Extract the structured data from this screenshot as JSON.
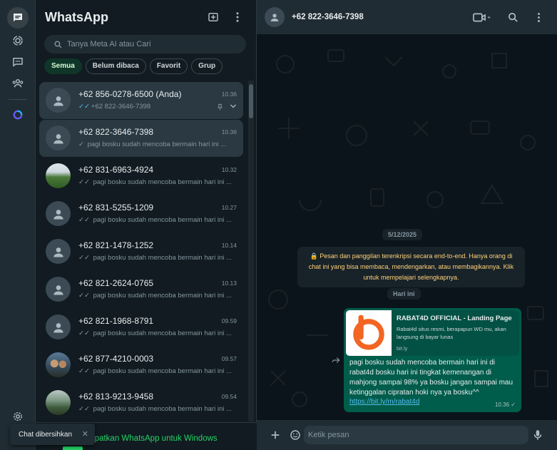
{
  "colors": {
    "accent": "#25d366",
    "bubble_out": "#005c4b",
    "panel": "#111b21",
    "header": "#202c33"
  },
  "sidebar": {
    "icons": [
      "chats-icon",
      "status-icon",
      "channels-icon",
      "communities-icon",
      "meta-ai-icon",
      "settings-icon"
    ]
  },
  "chat_list": {
    "title": "WhatsApp",
    "search_placeholder": "Tanya Meta AI atau Cari",
    "filters": [
      "Semua",
      "Belum dibaca",
      "Favorit",
      "Grup"
    ],
    "chats": [
      {
        "name": "+62 856-0278-6500 (Anda)",
        "time": "10.36",
        "tick": "✓✓",
        "preview": "+62 822-3646-7398"
      },
      {
        "name": "+62 822-3646-7398",
        "time": "10.36",
        "tick": "✓",
        "preview": "pagi bosku sudah mencoba bermain hari ini ..."
      },
      {
        "name": "+62 831-6963-4924",
        "time": "10.32",
        "tick": "✓✓",
        "preview": "pagi bosku sudah mencoba bermain hari ini ..."
      },
      {
        "name": "+62 831-5255-1209",
        "time": "10.27",
        "tick": "✓✓",
        "preview": "pagi bosku sudah mencoba bermain hari ini ..."
      },
      {
        "name": "+62 821-1478-1252",
        "time": "10.14",
        "tick": "✓✓",
        "preview": "pagi bosku sudah mencoba bermain hari ini ..."
      },
      {
        "name": "+62 821-2624-0765",
        "time": "10.13",
        "tick": "✓✓",
        "preview": "pagi bosku sudah mencoba bermain hari ini ..."
      },
      {
        "name": "+62 821-1968-8791",
        "time": "09.59",
        "tick": "✓✓",
        "preview": "pagi bosku sudah mencoba bermain hari ini ..."
      },
      {
        "name": "+62 877-4210-0003",
        "time": "09.57",
        "tick": "✓✓",
        "preview": "pagi bosku sudah mencoba bermain hari ini ..."
      },
      {
        "name": "+62 813-9213-9458",
        "time": "09.54",
        "tick": "✓✓",
        "preview": "pagi bosku sudah mencoba bermain hari ini ..."
      }
    ],
    "footer_text": "Dapatkan WhatsApp untuk Windows"
  },
  "toast": {
    "text": "Chat dibersihkan",
    "close": "✕"
  },
  "conversation": {
    "title": "+62 822-3646-7398",
    "date_label": "5/12/2025",
    "encryption_notice": "🔒 Pesan dan panggilan terenkripsi secara end-to-end. Hanya orang di chat ini yang bisa membaca, mendengarkan, atau membagikannya. Klik untuk mempelajari selengkapnya.",
    "today_label": "Hari ini",
    "message": {
      "preview_title": "RABAT4D OFFICIAL - Landing Page",
      "preview_desc": "Rabat4d situs resmi, berapapun WD mu, akan langsung di bayar lunas",
      "preview_domain": "bit.ly",
      "text": "pagi bosku sudah mencoba bermain hari ini di rabat4d bosku hari ini tingkat kemenangan di mahjong sampai 98% ya bosku jangan sampai mau ketinggalan cipratan hoki nya ya bosku^^",
      "link": "https://bit.ly/m/rabat4d",
      "time": "10.36 ✓"
    },
    "compose_placeholder": "Ketik pesan"
  }
}
